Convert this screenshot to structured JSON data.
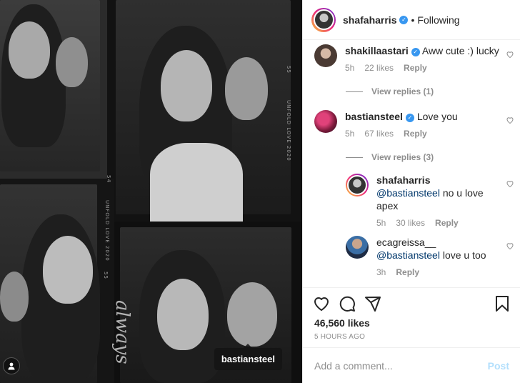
{
  "photo": {
    "film_texts": [
      "UNFOLD LOVE 2020",
      "UNFOLD LOVE 2020",
      "55",
      "54",
      "55"
    ],
    "tag_username": "bastiansteel",
    "script_text": "always"
  },
  "header": {
    "username": "shafaharris",
    "separator": "•",
    "follow_status": "Following"
  },
  "comments": [
    {
      "username": "shakillaastari",
      "verified": true,
      "text": "Aww cute :) lucky",
      "time": "5h",
      "likes": "22 likes",
      "reply_label": "Reply",
      "view_replies": "View replies (1)"
    },
    {
      "username": "bastiansteel",
      "verified": true,
      "text": "Love you",
      "time": "5h",
      "likes": "67 likes",
      "reply_label": "Reply",
      "view_replies": "View replies (3)"
    }
  ],
  "replies": [
    {
      "username": "shafaharris",
      "mention": "@bastiansteel",
      "text": "no u love apex",
      "time": "5h",
      "likes": "30 likes",
      "reply_label": "Reply"
    },
    {
      "username": "ecagreissa__",
      "mention": "@bastiansteel",
      "text": "love u too",
      "time": "3h",
      "reply_label": "Reply"
    }
  ],
  "footer": {
    "likes": "46,560 likes",
    "time_ago": "5 HOURS AGO",
    "comment_placeholder": "Add a comment...",
    "post_label": "Post"
  },
  "colors": {
    "verified": "#3897f0",
    "mention": "#00376b",
    "muted": "#8e8e8e",
    "post_disabled": "#b2dffc"
  }
}
